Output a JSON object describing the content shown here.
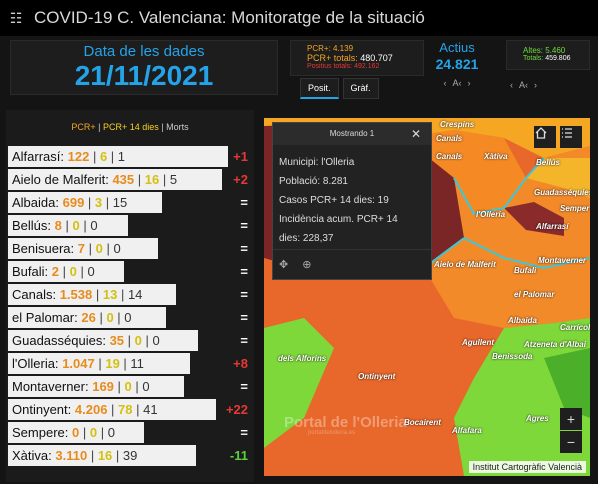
{
  "header": {
    "logo_icon": "chart-logo-icon",
    "title": "COVID-19 C. Valenciana: Monitoratge de la situació"
  },
  "date_panel": {
    "label": "Data de les dades",
    "value": "21/11/2021"
  },
  "pcr_panel": {
    "line1": "PCR+: 4.139",
    "line2_label": "PCR+ totals: ",
    "line2_value": "480.707",
    "line3": "Positius totals: 492.162",
    "tabs": [
      "Posit.",
      "Gràf."
    ]
  },
  "actius_panel": {
    "label": "Actius",
    "value": "24.821",
    "nav": [
      "‹",
      "A‹",
      "›"
    ]
  },
  "altes_panel": {
    "line1": "Altes: 5.460",
    "line2_label": "Totals: ",
    "line2_value": "459.806",
    "nav": [
      "‹",
      "A‹",
      "›"
    ]
  },
  "list": {
    "header_pcr": "PCR+",
    "header_pcr14": "PCR+ 14 dies",
    "header_morts": "Morts",
    "rows": [
      {
        "name": "Alfarrasí:",
        "pcr": "122",
        "pcr14": "6",
        "morts": "1",
        "delta": "+1",
        "delta_color": "#e53935",
        "bar": 220
      },
      {
        "name": "Aielo de Malferit:",
        "pcr": "435",
        "pcr14": "16",
        "morts": "5",
        "delta": "+2",
        "delta_color": "#e53935",
        "bar": 214
      },
      {
        "name": "Albaida:",
        "pcr": "699",
        "pcr14": "3",
        "morts": "15",
        "delta": "=",
        "delta_color": "#ffffff",
        "bar": 154
      },
      {
        "name": "Bellús:",
        "pcr": "8",
        "pcr14": "0",
        "morts": "0",
        "delta": "=",
        "delta_color": "#ffffff",
        "bar": 120
      },
      {
        "name": "Benisuera:",
        "pcr": "7",
        "pcr14": "0",
        "morts": "0",
        "delta": "=",
        "delta_color": "#ffffff",
        "bar": 150
      },
      {
        "name": "Bufali:",
        "pcr": "2",
        "pcr14": "0",
        "morts": "0",
        "delta": "=",
        "delta_color": "#ffffff",
        "bar": 116
      },
      {
        "name": "Canals:",
        "pcr": "1.538",
        "pcr14": "13",
        "morts": "14",
        "delta": "=",
        "delta_color": "#ffffff",
        "bar": 168
      },
      {
        "name": "el Palomar:",
        "pcr": "26",
        "pcr14": "0",
        "morts": "0",
        "delta": "=",
        "delta_color": "#ffffff",
        "bar": 158
      },
      {
        "name": "Guadasséquies:",
        "pcr": "35",
        "pcr14": "0",
        "morts": "0",
        "delta": "=",
        "delta_color": "#ffffff",
        "bar": 190
      },
      {
        "name": "l'Olleria:",
        "pcr": "1.047",
        "pcr14": "19",
        "morts": "11",
        "delta": "+8",
        "delta_color": "#e53935",
        "bar": 182
      },
      {
        "name": "Montaverner:",
        "pcr": "169",
        "pcr14": "0",
        "morts": "0",
        "delta": "=",
        "delta_color": "#ffffff",
        "bar": 176
      },
      {
        "name": "Ontinyent:",
        "pcr": "4.206",
        "pcr14": "78",
        "morts": "41",
        "delta": "+22",
        "delta_color": "#e53935",
        "bar": 208
      },
      {
        "name": "Sempere:",
        "pcr": "0",
        "pcr14": "0",
        "morts": "0",
        "delta": "=",
        "delta_color": "#ffffff",
        "bar": 136
      },
      {
        "name": "Xàtiva:",
        "pcr": "3.110",
        "pcr14": "16",
        "morts": "39",
        "delta": "-11",
        "delta_color": "#5cd23a",
        "bar": 188
      }
    ]
  },
  "popup": {
    "title": "Mostrando 1",
    "lines": [
      "Municipi: l'Olleria",
      "Població: 8.281",
      "Casos PCR+ 14 dies: 19",
      "Incidència acum. PCR+ 14",
      "dies: 228,37"
    ]
  },
  "map": {
    "labels": [
      "Canals",
      "Xàtiva",
      "Bellús",
      "Crespins",
      "Guadasséquies",
      "Semper",
      "l'Olleria",
      "Alfarrasí",
      "Montaverner",
      "Bufali",
      "el Palomar",
      "Albaida",
      "Carrícol",
      "Agullent",
      "Atzeneta d'Albai",
      "Benissoda",
      "Ontinyent",
      "Bocairent",
      "Alfafara",
      "Agres",
      "dels Alforins",
      "Aielo de Malferit"
    ],
    "watermark": "Portal de l'Olleria",
    "watermark_sub": "portaldelolleria.es",
    "attribution": "Institut Cartogràfic Valencià",
    "zoom_in": "+",
    "zoom_out": "−"
  }
}
